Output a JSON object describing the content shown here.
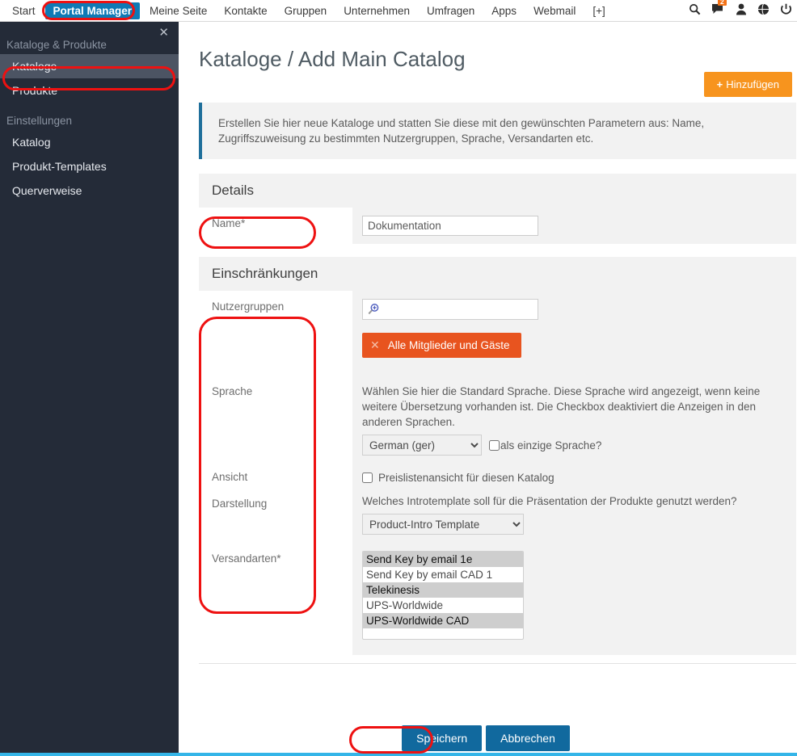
{
  "topnav": {
    "items": [
      {
        "label": "Start",
        "active": false
      },
      {
        "label": "Portal Manager",
        "active": true
      },
      {
        "label": "Meine Seite",
        "active": false
      },
      {
        "label": "Kontakte",
        "active": false
      },
      {
        "label": "Gruppen",
        "active": false
      },
      {
        "label": "Unternehmen",
        "active": false
      },
      {
        "label": "Umfragen",
        "active": false
      },
      {
        "label": "Apps",
        "active": false
      },
      {
        "label": "Webmail",
        "active": false
      },
      {
        "label": "[+]",
        "active": false
      }
    ],
    "icons": [
      {
        "name": "search-icon",
        "glyph": "search"
      },
      {
        "name": "messages-icon",
        "glyph": "message",
        "badge": "2"
      },
      {
        "name": "user-icon",
        "glyph": "user"
      },
      {
        "name": "globe-icon",
        "glyph": "globe"
      },
      {
        "name": "power-icon",
        "glyph": "power"
      }
    ],
    "accent_active": "#0f7ab5",
    "badge_color": "#f47216"
  },
  "sidebar": {
    "close_label": "✕",
    "groups": [
      {
        "title": "Kataloge & Produkte",
        "items": [
          {
            "label": "Kataloge",
            "selected": true
          },
          {
            "label": "Produkte",
            "selected": false
          }
        ]
      },
      {
        "title": "Einstellungen",
        "items": [
          {
            "label": "Katalog",
            "selected": false
          },
          {
            "label": "Produkt-Templates",
            "selected": false
          },
          {
            "label": "Querverweise",
            "selected": false
          }
        ]
      }
    ],
    "background": "#242b38",
    "selected_background": "#4c5463"
  },
  "main": {
    "page_title": "Kataloge / Add Main Catalog",
    "add_button": {
      "label": "Hinzufügen",
      "plus": "+",
      "color": "#f7941e"
    },
    "alert_text": "Erstellen Sie hier neue Kataloge und statten Sie diese mit den gewünschten Parametern aus: Name, Zugriffszuweisung zu bestimmten Nutzergruppen, Sprache, Versandarten etc.",
    "sections": [
      {
        "title": "Details"
      },
      {
        "title": "Einschränkungen"
      }
    ],
    "fields": {
      "name": {
        "label": "Name*",
        "value": "Dokumentation",
        "placeholder": ""
      },
      "usergroups": {
        "label": "Nutzergruppen",
        "search_value": "",
        "search_placeholder": "",
        "tags": [
          {
            "label": "Alle Mitglieder und Gäste",
            "remove": "✕"
          }
        ]
      },
      "language": {
        "label": "Sprache",
        "help": "Wählen Sie hier die Standard Sprache. Diese Sprache wird angezeigt, wenn keine weitere Übersetzung vorhanden ist. Die Checkbox deaktiviert die Anzeigen in den anderen Sprachen.",
        "selected": "German (ger)",
        "options": [
          "German (ger)"
        ],
        "checkbox_label": "als einzige Sprache?",
        "checkbox_checked": false
      },
      "view": {
        "label": "Ansicht",
        "checkbox_label": "Preislistenansicht für diesen Katalog",
        "checkbox_checked": false
      },
      "presentation": {
        "label": "Darstellung",
        "help": "Welches Introtemplate soll für die Präsentation der Produkte genutzt werden?",
        "selected": "Product-Intro Template",
        "options": [
          "Product-Intro Template"
        ]
      },
      "shipping": {
        "label": "Versandarten*",
        "options": [
          {
            "label": "Send Key by email 1e",
            "selected": true
          },
          {
            "label": "Send Key by email CAD 1",
            "selected": false
          },
          {
            "label": "Telekinesis",
            "selected": true
          },
          {
            "label": "UPS-Worldwide",
            "selected": false
          },
          {
            "label": "UPS-Worldwide CAD",
            "selected": true
          }
        ]
      }
    },
    "footer": {
      "save_label": "Speichern",
      "cancel_label": "Abbrechen",
      "button_color": "#11699e"
    }
  },
  "annotations": {
    "color": "#ee1111",
    "targets": [
      "portal-manager-tab",
      "kataloge-sidebar-item",
      "name-label",
      "restriction-labels-column",
      "save-button"
    ]
  }
}
